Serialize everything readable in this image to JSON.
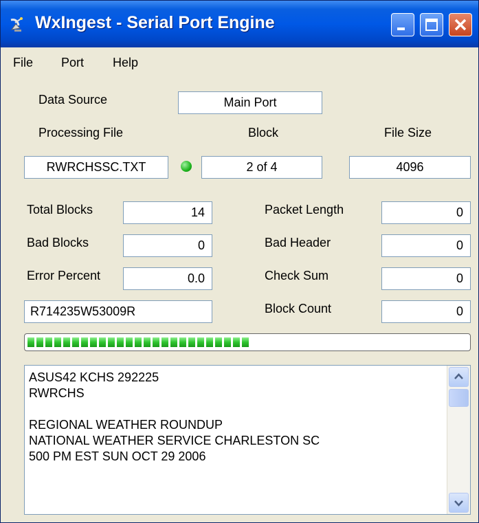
{
  "window": {
    "title": "WxIngest - Serial Port Engine"
  },
  "menu": {
    "items": [
      "File",
      "Port",
      "Help"
    ]
  },
  "data_source": {
    "label": "Data Source",
    "value": "Main Port"
  },
  "processing": {
    "file_label": "Processing File",
    "file_value": "RWRCHSSC.TXT",
    "block_label": "Block",
    "block_value": "2 of 4",
    "size_label": "File Size",
    "size_value": "4096",
    "status_color": "#1fb51f"
  },
  "stats_left": [
    {
      "label": "Total Blocks",
      "value": "14"
    },
    {
      "label": "Bad Blocks",
      "value": "0"
    },
    {
      "label": "Error Percent",
      "value": "0.0"
    }
  ],
  "stats_right": [
    {
      "label": "Packet Length",
      "value": "0"
    },
    {
      "label": "Bad Header",
      "value": "0"
    },
    {
      "label": "Check Sum",
      "value": "0"
    },
    {
      "label": "Block Count",
      "value": "0"
    }
  ],
  "id_field": {
    "value": "R714235W53009R"
  },
  "progress": {
    "fraction": 0.52,
    "color": "#2fc42f"
  },
  "memo": {
    "lines": [
      "ASUS42 KCHS 292225",
      "RWRCHS",
      "",
      "REGIONAL WEATHER ROUNDUP",
      "NATIONAL WEATHER SERVICE CHARLESTON SC",
      "500 PM EST SUN OCT 29 2006"
    ]
  },
  "icons": {
    "app": "satellite-dish-icon",
    "minimize": "minimize-icon",
    "maximize": "maximize-icon",
    "close": "close-icon",
    "scroll_up": "chevron-up-icon",
    "scroll_down": "chevron-down-icon"
  }
}
